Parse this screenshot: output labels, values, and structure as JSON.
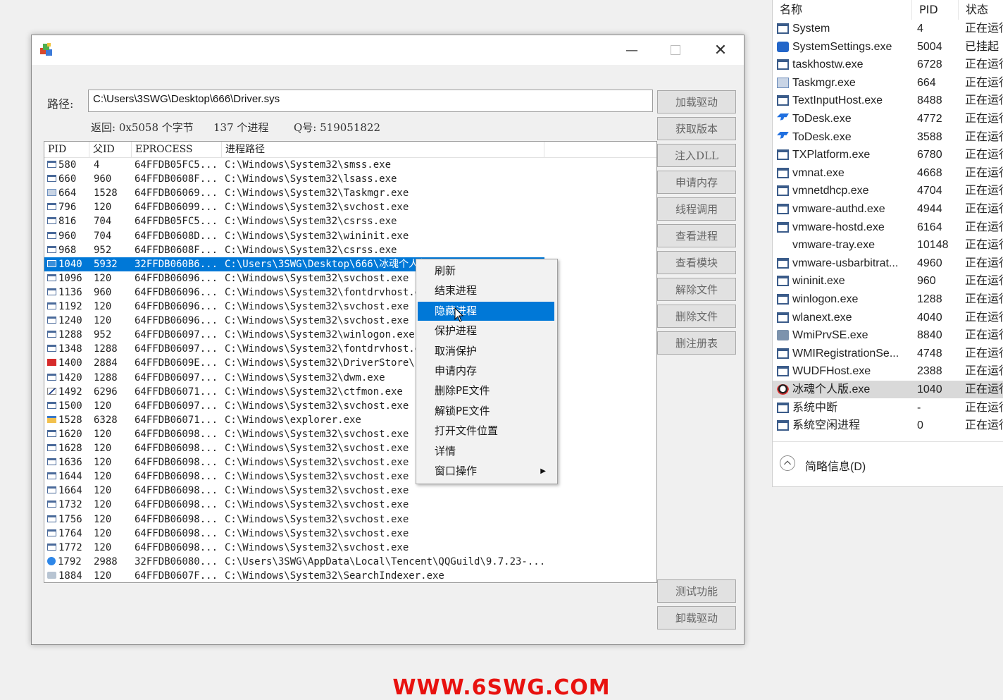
{
  "window": {
    "path_label": "路径:",
    "path_value": "C:\\Users\\3SWG\\Desktop\\666\\Driver.sys",
    "info_return": "返回: 0x5058 个字节",
    "info_procs": "137 个进程",
    "info_qq": "Q号: 519051822",
    "buttons": [
      "加载驱动",
      "获取版本",
      "注入DLL",
      "申请内存",
      "线程调用",
      "查看进程",
      "查看模块",
      "解除文件",
      "删除文件",
      "删注册表"
    ],
    "buttons_bottom": [
      "测试功能",
      "卸载驱动"
    ],
    "columns": [
      "PID",
      "父ID",
      "EPROCESS",
      "进程路径"
    ],
    "rows": [
      {
        "pid": "580",
        "ppid": "4",
        "ep": "64FFDB05FC5...",
        "path": "C:\\Windows\\System32\\smss.exe",
        "icon": "win"
      },
      {
        "pid": "660",
        "ppid": "960",
        "ep": "64FFDB0608F...",
        "path": "C:\\Windows\\System32\\lsass.exe",
        "icon": "win"
      },
      {
        "pid": "664",
        "ppid": "1528",
        "ep": "64FFDB06069...",
        "path": "C:\\Windows\\System32\\Taskmgr.exe",
        "icon": "tm"
      },
      {
        "pid": "796",
        "ppid": "120",
        "ep": "64FFDB06099...",
        "path": "C:\\Windows\\System32\\svchost.exe",
        "icon": "win"
      },
      {
        "pid": "816",
        "ppid": "704",
        "ep": "64FFDB05FC5...",
        "path": "C:\\Windows\\System32\\csrss.exe",
        "icon": "win"
      },
      {
        "pid": "960",
        "ppid": "704",
        "ep": "64FFDB0608D...",
        "path": "C:\\Windows\\System32\\wininit.exe",
        "icon": "win"
      },
      {
        "pid": "968",
        "ppid": "952",
        "ep": "64FFDB0608F...",
        "path": "C:\\Windows\\System32\\csrss.exe",
        "icon": "win"
      },
      {
        "pid": "1040",
        "ppid": "5932",
        "ep": "32FFDB060B6...",
        "path": "C:\\Users\\3SWG\\Desktop\\666\\冰魂个人版",
        "icon": "app",
        "selected": true
      },
      {
        "pid": "1096",
        "ppid": "120",
        "ep": "64FFDB06096...",
        "path": "C:\\Windows\\System32\\svchost.exe",
        "icon": "win"
      },
      {
        "pid": "1136",
        "ppid": "960",
        "ep": "64FFDB06096...",
        "path": "C:\\Windows\\System32\\fontdrvhost.e",
        "icon": "win"
      },
      {
        "pid": "1192",
        "ppid": "120",
        "ep": "64FFDB06096...",
        "path": "C:\\Windows\\System32\\svchost.exe",
        "icon": "win"
      },
      {
        "pid": "1240",
        "ppid": "120",
        "ep": "64FFDB06096...",
        "path": "C:\\Windows\\System32\\svchost.exe",
        "icon": "win"
      },
      {
        "pid": "1288",
        "ppid": "952",
        "ep": "64FFDB06097...",
        "path": "C:\\Windows\\System32\\winlogon.exe",
        "icon": "win"
      },
      {
        "pid": "1348",
        "ppid": "1288",
        "ep": "64FFDB06097...",
        "path": "C:\\Windows\\System32\\fontdrvhost.e",
        "icon": "win"
      },
      {
        "pid": "1400",
        "ppid": "2884",
        "ep": "64FFDB0609E...",
        "path": "C:\\Windows\\System32\\DriverStore\\F",
        "icon": "red"
      },
      {
        "pid": "1420",
        "ppid": "1288",
        "ep": "64FFDB06097...",
        "path": "C:\\Windows\\System32\\dwm.exe",
        "icon": "win"
      },
      {
        "pid": "1492",
        "ppid": "6296",
        "ep": "64FFDB06071...",
        "path": "C:\\Windows\\System32\\ctfmon.exe",
        "icon": "pen"
      },
      {
        "pid": "1500",
        "ppid": "120",
        "ep": "64FFDB06097...",
        "path": "C:\\Windows\\System32\\svchost.exe",
        "icon": "win"
      },
      {
        "pid": "1528",
        "ppid": "6328",
        "ep": "64FFDB06071...",
        "path": "C:\\Windows\\explorer.exe",
        "icon": "folder"
      },
      {
        "pid": "1620",
        "ppid": "120",
        "ep": "64FFDB06098...",
        "path": "C:\\Windows\\System32\\svchost.exe",
        "icon": "win"
      },
      {
        "pid": "1628",
        "ppid": "120",
        "ep": "64FFDB06098...",
        "path": "C:\\Windows\\System32\\svchost.exe",
        "icon": "win"
      },
      {
        "pid": "1636",
        "ppid": "120",
        "ep": "64FFDB06098...",
        "path": "C:\\Windows\\System32\\svchost.exe",
        "icon": "win"
      },
      {
        "pid": "1644",
        "ppid": "120",
        "ep": "64FFDB06098...",
        "path": "C:\\Windows\\System32\\svchost.exe",
        "icon": "win"
      },
      {
        "pid": "1664",
        "ppid": "120",
        "ep": "64FFDB06098...",
        "path": "C:\\Windows\\System32\\svchost.exe",
        "icon": "win"
      },
      {
        "pid": "1732",
        "ppid": "120",
        "ep": "64FFDB06098...",
        "path": "C:\\Windows\\System32\\svchost.exe",
        "icon": "win"
      },
      {
        "pid": "1756",
        "ppid": "120",
        "ep": "64FFDB06098...",
        "path": "C:\\Windows\\System32\\svchost.exe",
        "icon": "win"
      },
      {
        "pid": "1764",
        "ppid": "120",
        "ep": "64FFDB06098...",
        "path": "C:\\Windows\\System32\\svchost.exe",
        "icon": "win"
      },
      {
        "pid": "1772",
        "ppid": "120",
        "ep": "64FFDB06098...",
        "path": "C:\\Windows\\System32\\svchost.exe",
        "icon": "win"
      },
      {
        "pid": "1792",
        "ppid": "2988",
        "ep": "32FFDB06080...",
        "path": "C:\\Users\\3SWG\\AppData\\Local\\Tencent\\QQGuild\\9.7.23-...",
        "icon": "qq"
      },
      {
        "pid": "1884",
        "ppid": "120",
        "ep": "64FFDB0607F...",
        "path": "C:\\Windows\\System32\\SearchIndexer.exe",
        "icon": "search"
      }
    ]
  },
  "context_menu": {
    "items": [
      "刷新",
      "结束进程",
      "隐藏进程",
      "保护进程",
      "取消保护",
      "申请内存",
      "删除PE文件",
      "解锁PE文件",
      "打开文件位置",
      "详情",
      "窗口操作"
    ],
    "highlighted": 2
  },
  "taskmgr": {
    "columns": [
      "名称",
      "PID",
      "状态"
    ],
    "rows": [
      {
        "name": "System",
        "pid": "4",
        "status": "正在运行",
        "icon": "win"
      },
      {
        "name": "SystemSettings.exe",
        "pid": "5004",
        "status": "已挂起",
        "icon": "gear"
      },
      {
        "name": "taskhostw.exe",
        "pid": "6728",
        "status": "正在运行",
        "icon": "win"
      },
      {
        "name": "Taskmgr.exe",
        "pid": "664",
        "status": "正在运行",
        "icon": "tm"
      },
      {
        "name": "TextInputHost.exe",
        "pid": "8488",
        "status": "正在运行",
        "icon": "win"
      },
      {
        "name": "ToDesk.exe",
        "pid": "4772",
        "status": "正在运行",
        "icon": "todesk"
      },
      {
        "name": "ToDesk.exe",
        "pid": "3588",
        "status": "正在运行",
        "icon": "todesk"
      },
      {
        "name": "TXPlatform.exe",
        "pid": "6780",
        "status": "正在运行",
        "icon": "win"
      },
      {
        "name": "vmnat.exe",
        "pid": "4668",
        "status": "正在运行",
        "icon": "win"
      },
      {
        "name": "vmnetdhcp.exe",
        "pid": "4704",
        "status": "正在运行",
        "icon": "win"
      },
      {
        "name": "vmware-authd.exe",
        "pid": "4944",
        "status": "正在运行",
        "icon": "win"
      },
      {
        "name": "vmware-hostd.exe",
        "pid": "6164",
        "status": "正在运行",
        "icon": "win"
      },
      {
        "name": "vmware-tray.exe",
        "pid": "10148",
        "status": "正在运行",
        "icon": "none"
      },
      {
        "name": "vmware-usbarbitrat...",
        "pid": "4960",
        "status": "正在运行",
        "icon": "win"
      },
      {
        "name": "wininit.exe",
        "pid": "960",
        "status": "正在运行",
        "icon": "win"
      },
      {
        "name": "winlogon.exe",
        "pid": "1288",
        "status": "正在运行",
        "icon": "win"
      },
      {
        "name": "wlanext.exe",
        "pid": "4040",
        "status": "正在运行",
        "icon": "win"
      },
      {
        "name": "WmiPrvSE.exe",
        "pid": "8840",
        "status": "正在运行",
        "icon": "wmi"
      },
      {
        "name": "WMIRegistrationSe...",
        "pid": "4748",
        "status": "正在运行",
        "icon": "win"
      },
      {
        "name": "WUDFHost.exe",
        "pid": "2388",
        "status": "正在运行",
        "icon": "win"
      },
      {
        "name": "冰魂个人版.exe",
        "pid": "1040",
        "status": "正在运行",
        "icon": "ice",
        "selected": true
      },
      {
        "name": "系统中断",
        "pid": "-",
        "status": "正在运行",
        "icon": "win"
      },
      {
        "name": "系统空闲进程",
        "pid": "0",
        "status": "正在运行",
        "icon": "win"
      }
    ],
    "fewer_details": "简略信息(D)"
  },
  "watermark": "WWW.6SWG.COM"
}
